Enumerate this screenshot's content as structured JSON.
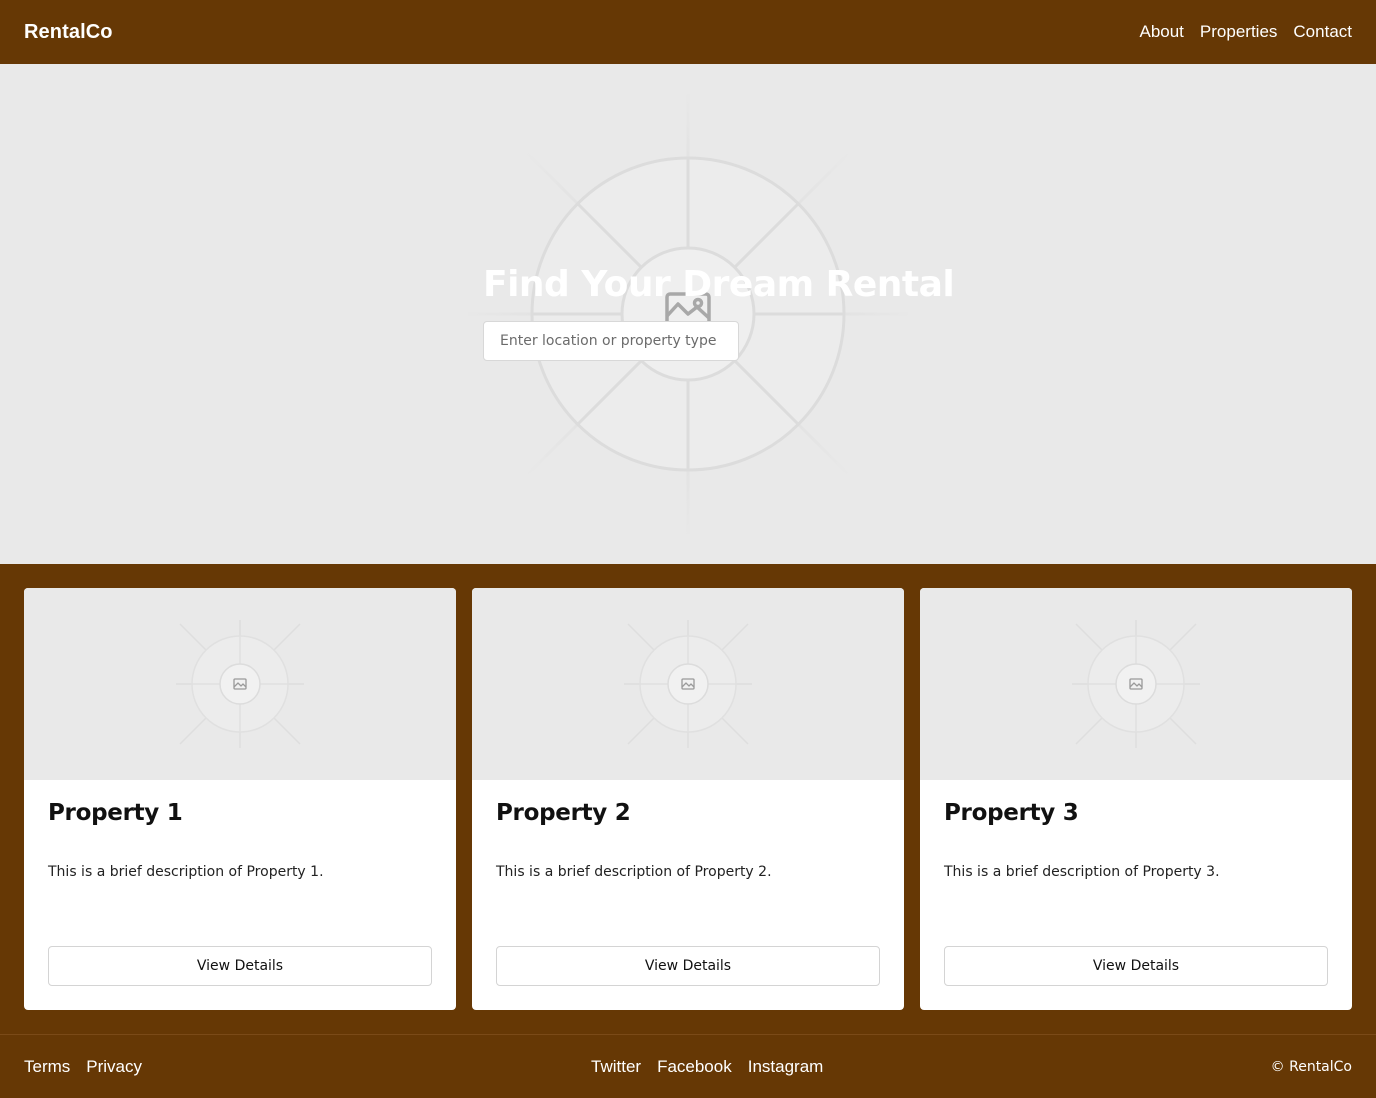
{
  "header": {
    "brand": "RentalCo",
    "nav": [
      "About",
      "Properties",
      "Contact"
    ]
  },
  "hero": {
    "title": "Find Your Dream Rental",
    "search_placeholder": "Enter location or property type",
    "image_icon": "image-placeholder-icon"
  },
  "properties": [
    {
      "title": "Property 1",
      "description": "This is a brief description of Property 1.",
      "button": "View Details"
    },
    {
      "title": "Property 2",
      "description": "This is a brief description of Property 2.",
      "button": "View Details"
    },
    {
      "title": "Property 3",
      "description": "This is a brief description of Property 3.",
      "button": "View Details"
    }
  ],
  "footer": {
    "links": [
      "Terms",
      "Privacy"
    ],
    "social": [
      "Twitter",
      "Facebook",
      "Instagram"
    ],
    "copyright": "© RentalCo"
  },
  "colors": {
    "brand_brown": "#663805",
    "placeholder_gray": "#e9e9e9"
  }
}
